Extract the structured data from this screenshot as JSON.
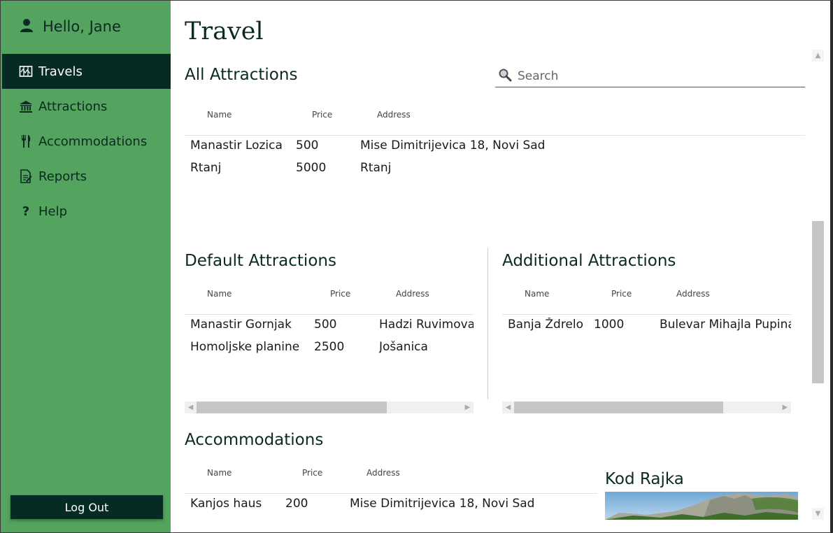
{
  "sidebar": {
    "greeting": "Hello, Jane",
    "items": [
      {
        "label": "Travels",
        "icon": "map-icon",
        "active": true
      },
      {
        "label": "Attractions",
        "icon": "museum-icon",
        "active": false
      },
      {
        "label": "Accommodations",
        "icon": "fork-knife-icon",
        "active": false
      },
      {
        "label": "Reports",
        "icon": "report-icon",
        "active": false
      },
      {
        "label": "Help",
        "icon": "question-icon",
        "active": false
      }
    ],
    "logout_label": "Log Out"
  },
  "main": {
    "title": "Travel",
    "all_attractions": {
      "heading": "All Attractions",
      "search_placeholder": "Search",
      "columns": [
        "Name",
        "Price",
        "Address"
      ],
      "rows": [
        [
          "Manastir Lozica",
          "500",
          "Mise Dimitrijevica 18, Novi Sad"
        ],
        [
          "Rtanj",
          "5000",
          "Rtanj"
        ]
      ]
    },
    "default_attractions": {
      "heading": "Default Attractions",
      "columns": [
        "Name",
        "Price",
        "Address"
      ],
      "rows": [
        [
          "Manastir Gornjak",
          "500",
          "Hadzi Ruvimova"
        ],
        [
          "Homoljske planine",
          "2500",
          "Jošanica"
        ]
      ]
    },
    "additional_attractions": {
      "heading": "Additional Attractions",
      "columns": [
        "Name",
        "Price",
        "Address"
      ],
      "rows": [
        [
          "Banja Ždrelo",
          "1000",
          "Bulevar Mihajla Pupina"
        ]
      ]
    },
    "accommodations": {
      "heading": "Accommodations",
      "columns": [
        "Name",
        "Price",
        "Address"
      ],
      "rows": [
        [
          "Kanjos haus",
          "200",
          "Mise Dimitrijevica 18, Novi Sad"
        ]
      ],
      "selected_title": "Kod Rajka"
    }
  },
  "colors": {
    "sidebar_bg": "#54a35e",
    "active_bg": "#062b24",
    "text_dark": "#0b2a22"
  }
}
